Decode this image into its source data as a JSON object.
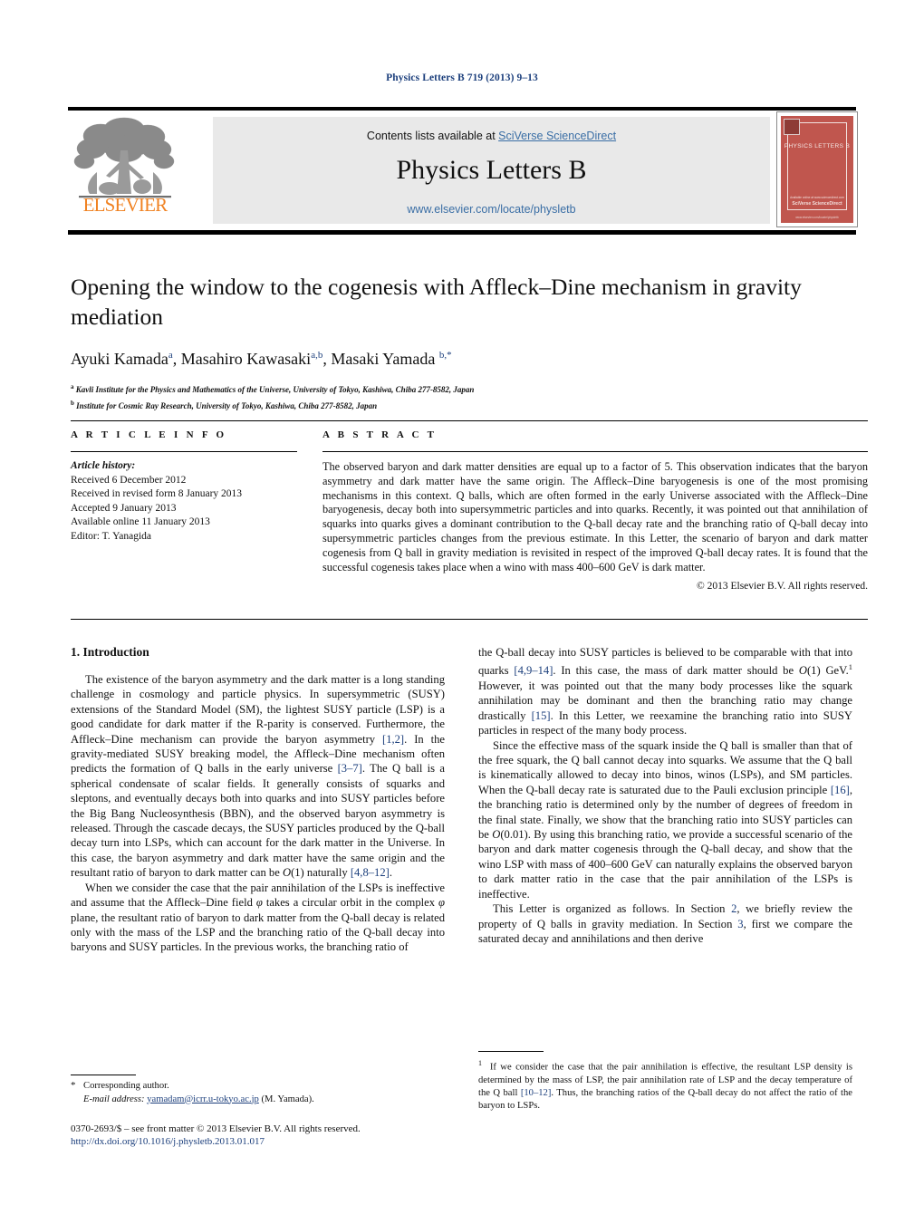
{
  "journal_ref": "Physics Letters B 719 (2013) 9–13",
  "masthead": {
    "contents_prefix": "Contents lists available at ",
    "contents_link": "SciVerse ScienceDirect",
    "journal_title": "Physics Letters B",
    "journal_url": "www.elsevier.com/locate/physletb",
    "publisher_wordmark": "ELSEVIER",
    "publisher_logo_name": "elsevier-tree-logo",
    "cover": {
      "title": "PHYSICS LETTERS B",
      "foot_small": "Available online at www.sciencedirect.com",
      "foot_brand": "SciVerse ScienceDirect",
      "foot_tiny": "www.elsevier.com/locate/physletb",
      "accent_color": "#c0564e"
    }
  },
  "article": {
    "title": "Opening the window to the cogenesis with Affleck–Dine mechanism in gravity mediation",
    "authors_html": "Ayuki Kamada <sup>a</sup>, Masahiro Kawasaki <sup>a,b</sup>, Masaki Yamada <sup>b,</sup><sup>*</sup>",
    "authors_plain": "Ayuki Kamada a, Masahiro Kawasaki a,b, Masaki Yamada b,*",
    "affiliations": [
      {
        "marker": "a",
        "text": "Kavli Institute for the Physics and Mathematics of the Universe, University of Tokyo, Kashiwa, Chiba 277-8582, Japan"
      },
      {
        "marker": "b",
        "text": "Institute for Cosmic Ray Research, University of Tokyo, Kashiwa, Chiba 277-8582, Japan"
      }
    ]
  },
  "article_info": {
    "heading": "A R T I C L E   I N F O",
    "history_label": "Article history:",
    "history": [
      "Received 6 December 2012",
      "Received in revised form 8 January 2013",
      "Accepted 9 January 2013",
      "Available online 11 January 2013",
      "Editor: T. Yanagida"
    ]
  },
  "abstract": {
    "heading": "A B S T R A C T",
    "text": "The observed baryon and dark matter densities are equal up to a factor of 5. This observation indicates that the baryon asymmetry and dark matter have the same origin. The Affleck–Dine baryogenesis is one of the most promising mechanisms in this context. Q balls, which are often formed in the early Universe associated with the Affleck–Dine baryogenesis, decay both into supersymmetric particles and into quarks. Recently, it was pointed out that annihilation of squarks into quarks gives a dominant contribution to the Q-ball decay rate and the branching ratio of Q-ball decay into supersymmetric particles changes from the previous estimate. In this Letter, the scenario of baryon and dark matter cogenesis from Q ball in gravity mediation is revisited in respect of the improved Q-ball decay rates. It is found that the successful cogenesis takes place when a wino with mass 400–600 GeV is dark matter.",
    "copyright": "© 2013 Elsevier B.V. All rights reserved."
  },
  "body": {
    "section1_title": "1. Introduction",
    "left_paragraphs": [
      "The existence of the baryon asymmetry and the dark matter is a long standing challenge in cosmology and particle physics. In supersymmetric (SUSY) extensions of the Standard Model (SM), the lightest SUSY particle (LSP) is a good candidate for dark matter if the R-parity is conserved. Furthermore, the Affleck–Dine mechanism can provide the baryon asymmetry [1,2]. In the gravity-mediated SUSY breaking model, the Affleck–Dine mechanism often predicts the formation of Q balls in the early universe [3–7]. The Q ball is a spherical condensate of scalar fields. It generally consists of squarks and sleptons, and eventually decays both into quarks and into SUSY particles before the Big Bang Nucleosynthesis (BBN), and the observed baryon asymmetry is released. Through the cascade decays, the SUSY particles produced by the Q-ball decay turn into LSPs, which can account for the dark matter in the Universe. In this case, the baryon asymmetry and dark matter have the same origin and the resultant ratio of baryon to dark matter can be O(1) naturally [4,8–12].",
      "When we consider the case that the pair annihilation of the LSPs is ineffective and assume that the Affleck–Dine field φ takes a circular orbit in the complex φ plane, the resultant ratio of baryon to dark matter from the Q-ball decay is related only with the mass of the LSP and the branching ratio of the Q-ball decay into baryons and SUSY particles. In the previous works, the branching ratio of"
    ],
    "right_paragraphs": [
      "the Q-ball decay into SUSY particles is believed to be comparable with that into quarks [4,9–14]. In this case, the mass of dark matter should be O(1) GeV.1 However, it was pointed out that the many body processes like the squark annihilation may be dominant and then the branching ratio may change drastically [15]. In this Letter, we reexamine the branching ratio into SUSY particles in respect of the many body process.",
      "Since the effective mass of the squark inside the Q ball is smaller than that of the free squark, the Q ball cannot decay into squarks. We assume that the Q ball is kinematically allowed to decay into binos, winos (LSPs), and SM particles. When the Q-ball decay rate is saturated due to the Pauli exclusion principle [16], the branching ratio is determined only by the number of degrees of freedom in the final state. Finally, we show that the branching ratio into SUSY particles can be O(0.01). By using this branching ratio, we provide a successful scenario of the baryon and dark matter cogenesis through the Q-ball decay, and show that the wino LSP with mass of 400–600 GeV can naturally explains the observed baryon to dark matter ratio in the case that the pair annihilation of the LSPs is ineffective.",
      "This Letter is organized as follows. In Section 2, we briefly review the property of Q balls in gravity mediation. In Section 3, first we compare the saturated decay and annihilations and then derive"
    ],
    "footnote": {
      "marker": "1",
      "text": "If we consider the case that the pair annihilation is effective, the resultant LSP density is determined by the mass of LSP, the pair annihilation rate of LSP and the decay temperature of the Q ball [10–12]. Thus, the branching ratios of the Q-ball decay do not affect the ratio of the baryon to LSPs."
    }
  },
  "footer": {
    "corresponding_star": "*",
    "corresponding_label": "Corresponding author.",
    "email_label": "E-mail address:",
    "email": "yamadam@icrr.u-tokyo.ac.jp",
    "email_owner": "(M. Yamada).",
    "issn_line": "0370-2693/$ – see front matter © 2013 Elsevier B.V. All rights reserved.",
    "doi": "http://dx.doi.org/10.1016/j.physletb.2013.01.017"
  },
  "colors": {
    "link_blue": "#1c3f7c",
    "masthead_gray": "#e9e9e9",
    "elsevier_orange": "#f08222",
    "cover_red": "#c0564e"
  }
}
